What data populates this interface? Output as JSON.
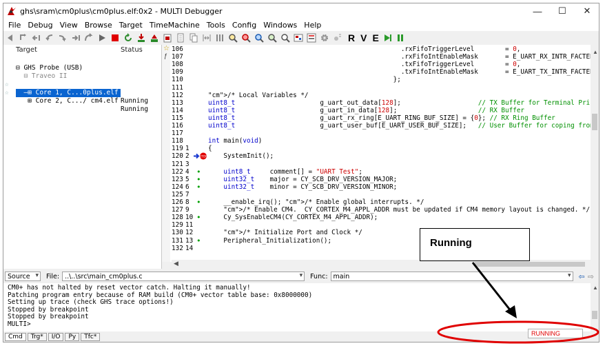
{
  "window": {
    "title": "ghs\\sram\\cm0plus\\cm0plus.elf:0x2 - MULTI Debugger",
    "minimize_glyph": "—",
    "maximize_glyph": "☐",
    "close_glyph": "✕"
  },
  "menu": [
    "File",
    "Debug",
    "View",
    "Browse",
    "Target",
    "TimeMachine",
    "Tools",
    "Config",
    "Windows",
    "Help"
  ],
  "toolbar": {
    "letters": [
      "R",
      "V",
      "E"
    ]
  },
  "tree": {
    "col_target": "Target",
    "col_status": "Status",
    "rows": [
      {
        "text": "⊟ GHS Probe (USB)",
        "status": ""
      },
      {
        "text": "  ⊟ Traveo II",
        "status": ""
      },
      {
        "text": "  –⊞ Core 1, C...0plus.elf",
        "status": "Running"
      },
      {
        "text": "   ⊞ Core 2, C.../ cm4.elf",
        "status": "Running"
      }
    ]
  },
  "code": {
    "lines": [
      {
        "ln": "106",
        "sn": "",
        "mark": "",
        "text": "                                                  .rxFifoTriggerLevel        = 0,"
      },
      {
        "ln": "107",
        "sn": "",
        "mark": "",
        "text": "                                                  .rxFifoIntEnableMask       = E_UART_RX_INTR_FACTER,"
      },
      {
        "ln": "108",
        "sn": "",
        "mark": "",
        "text": "                                                  .txFifoTriggerLevel        = 0,"
      },
      {
        "ln": "109",
        "sn": "",
        "mark": "",
        "text": "                                                  .txFifoIntEnableMask       = E_UART_TX_INTR_FACTER"
      },
      {
        "ln": "110",
        "sn": "",
        "mark": "",
        "text": "                                                };"
      },
      {
        "ln": "111",
        "sn": "",
        "mark": "",
        "text": ""
      },
      {
        "ln": "112",
        "sn": "",
        "mark": "",
        "text": "/* Local Variables */"
      },
      {
        "ln": "113",
        "sn": "",
        "mark": "",
        "text": "uint8_t                      g_uart_out_data[128];                    // TX Buffer for Terminal Print"
      },
      {
        "ln": "114",
        "sn": "",
        "mark": "",
        "text": "uint8_t                      g_uart_in_data[128];                     // RX Buffer"
      },
      {
        "ln": "115",
        "sn": "",
        "mark": "",
        "text": "uint8_t                      g_uart_rx_ring[E_UART_RING_BUF_SIZE] = {0}; // RX Ring Buffer"
      },
      {
        "ln": "116",
        "sn": "",
        "mark": "",
        "text": "uint8_t                      g_uart_user_buf[E_UART_USER_BUF_SIZE];   // User Buffer for coping from R"
      },
      {
        "ln": "117",
        "sn": "",
        "mark": "",
        "text": ""
      },
      {
        "ln": "118",
        "sn": "",
        "mark": "",
        "text": "int main(void)"
      },
      {
        "ln": "119",
        "sn": "1",
        "mark": "",
        "text": "{"
      },
      {
        "ln": "120",
        "sn": "2",
        "mark": "pc",
        "text": "    SystemInit();"
      },
      {
        "ln": "121",
        "sn": "3",
        "mark": "",
        "text": ""
      },
      {
        "ln": "122",
        "sn": "4",
        "mark": "dot",
        "text": "    uint8_t     comment[] = \"UART Test\";"
      },
      {
        "ln": "123",
        "sn": "5",
        "mark": "dot",
        "text": "    uint32_t    major = CY_SCB_DRV_VERSION_MAJOR;"
      },
      {
        "ln": "124",
        "sn": "6",
        "mark": "dot",
        "text": "    uint32_t    minor = CY_SCB_DRV_VERSION_MINOR;"
      },
      {
        "ln": "125",
        "sn": "7",
        "mark": "",
        "text": ""
      },
      {
        "ln": "126",
        "sn": "8",
        "mark": "dot",
        "text": "    __enable_irq(); /* Enable global interrupts. */"
      },
      {
        "ln": "127",
        "sn": "9",
        "mark": "",
        "text": "    /* Enable CM4.  CY_CORTEX_M4_APPL_ADDR must be updated if CM4 memory layout is changed. */"
      },
      {
        "ln": "128",
        "sn": "10",
        "mark": "dot",
        "text": "    Cy_SysEnableCM4(CY_CORTEX_M4_APPL_ADDR);"
      },
      {
        "ln": "129",
        "sn": "11",
        "mark": "",
        "text": ""
      },
      {
        "ln": "130",
        "sn": "12",
        "mark": "",
        "text": "    /* Initialize Port and Clock */"
      },
      {
        "ln": "131",
        "sn": "13",
        "mark": "dot",
        "text": "    Peripheral_Initialization();"
      },
      {
        "ln": "132",
        "sn": "14",
        "mark": "",
        "text": ""
      }
    ]
  },
  "source_bar": {
    "mode": "Source",
    "file_label": "File:",
    "file_value": "..\\..\\src\\main_cm0plus.c",
    "func_label": "Func:",
    "func_value": "main"
  },
  "console": {
    "lines": [
      "CM0+ has not halted by reset vector catch. Halting it manually!",
      "Patching program entry because of RAM build (CM0+ vector table base: 0x8000000)",
      "Setting up trace (check GHS trace options!)",
      "Stopped by breakpoint",
      "Stopped by breakpoint",
      "MULTI>"
    ]
  },
  "bottom_tabs": [
    "Cmd",
    "Trg*",
    "I/O",
    "Py",
    "Tfc*"
  ],
  "status": {
    "text": "RUNNING",
    "color": "#e00000"
  },
  "callout": {
    "text": "Running",
    "ellipse_color": "#e00000"
  }
}
